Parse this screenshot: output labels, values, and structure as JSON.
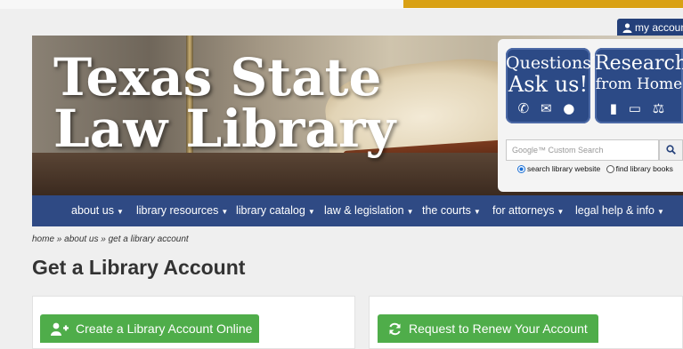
{
  "account": {
    "label": "my accoun"
  },
  "hero": {
    "title_line1": "Texas State",
    "title_line2": "Law Library"
  },
  "side_panel": {
    "ask_tile": {
      "line1": "Questions?",
      "line2": "Ask us!",
      "icons": "✆ ✉ ●"
    },
    "research_tile": {
      "line1": "Research",
      "line2": "from Home",
      "icons": "▮ ▭ ⚖"
    },
    "search": {
      "placeholder": "Google™ Custom Search"
    },
    "radio_options": [
      {
        "label": "search library website",
        "checked": true
      },
      {
        "label": "find library books",
        "checked": false
      }
    ]
  },
  "nav": {
    "items": [
      {
        "label": "about us"
      },
      {
        "label": "library resources"
      },
      {
        "label": "library catalog"
      },
      {
        "label": "law & legislation"
      },
      {
        "label": "the courts"
      },
      {
        "label": "for attorneys"
      },
      {
        "label": "legal help & info"
      }
    ]
  },
  "breadcrumb": {
    "text": "home » about us » get a library account"
  },
  "page": {
    "title": "Get a Library Account"
  },
  "actions": {
    "create": {
      "label": "Create a Library Account Online"
    },
    "renew": {
      "label": "Request to Renew Your Account"
    }
  },
  "colors": {
    "brand_blue": "#2f4a84",
    "accent_gold": "#d9a114",
    "button_green": "#4fad4a"
  }
}
